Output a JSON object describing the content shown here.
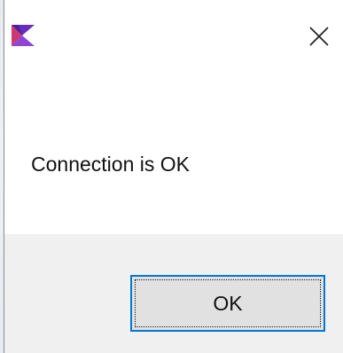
{
  "dialog": {
    "app_icon": "app-logo-icon",
    "close_icon": "close-icon",
    "message": "Connection is OK",
    "ok_label": "OK"
  },
  "colors": {
    "focus_border": "#0078d7",
    "button_face": "#e1e1e1",
    "footer_background": "#f0f0f0",
    "logo_primary": "#6b2bbf",
    "logo_secondary": "#c2185b"
  }
}
